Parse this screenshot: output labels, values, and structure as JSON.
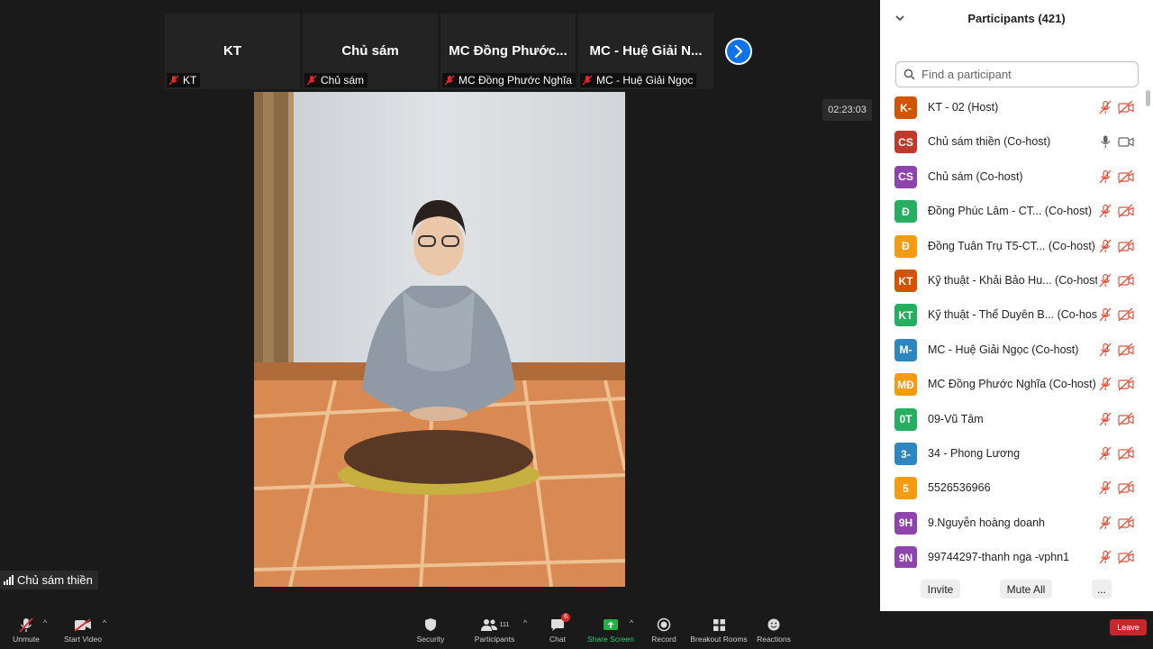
{
  "thumbnails": [
    {
      "name": "KT",
      "label": "KT"
    },
    {
      "name": "Chủ sám",
      "label": "Chủ sám"
    },
    {
      "name": "MC  Đồng  Phước...",
      "label": "MC Đồng Phước Nghĩa"
    },
    {
      "name": "MC  -  Huệ Giải N...",
      "label": "MC - Huệ Giải Ngọc"
    }
  ],
  "timer": "02:23:03",
  "active_speaker": "Chủ sám thiền",
  "toolbar": {
    "unmute": "Unmute",
    "start_video": "Start Video",
    "security": "Security",
    "participants": "Participants",
    "participants_count": "111",
    "chat": "Chat",
    "chat_badge": "6",
    "share_screen": "Share Screen",
    "record": "Record",
    "breakout_rooms": "Breakout Rooms",
    "reactions": "Reactions",
    "leave": "Leave"
  },
  "panel": {
    "title": "Participants (421)",
    "search_placeholder": "Find a participant",
    "participants": [
      {
        "initials": "K-",
        "name": "KT - 02 (Host)",
        "color": "#d35400",
        "audio": "muted",
        "video": "off"
      },
      {
        "initials": "CS",
        "name": "Chủ sám thiền (Co-host)",
        "color": "#c0392b",
        "audio": "on",
        "video": "on"
      },
      {
        "initials": "CS",
        "name": "Chủ sám (Co-host)",
        "color": "#8e44ad",
        "audio": "muted",
        "video": "off"
      },
      {
        "initials": "Đ",
        "name": "Đồng Phúc Lâm -  CT...  (Co-host)",
        "color": "#27ae60",
        "audio": "muted",
        "video": "off"
      },
      {
        "initials": "Đ",
        "name": "Đồng Tuân Trụ T5-CT...  (Co-host)",
        "color": "#f39c12",
        "audio": "muted",
        "video": "off"
      },
      {
        "initials": "KT",
        "name": "Kỹ thuật - Khải Bảo Hu...  (Co-host)",
        "color": "#d35400",
        "audio": "muted",
        "video": "off"
      },
      {
        "initials": "KT",
        "name": "Kỹ thuật - Thể Duyên B...  (Co-host)",
        "color": "#27ae60",
        "audio": "muted",
        "video": "off"
      },
      {
        "initials": "M-",
        "name": "MC - Huệ Giải Ngọc (Co-host)",
        "color": "#2e86c1",
        "audio": "muted",
        "video": "off"
      },
      {
        "initials": "MĐ",
        "name": "MC Đồng Phước Nghĩa (Co-host)",
        "color": "#f39c12",
        "audio": "muted",
        "video": "off"
      },
      {
        "initials": "0T",
        "name": "09-Vũ Tâm",
        "color": "#27ae60",
        "audio": "muted",
        "video": "off"
      },
      {
        "initials": "3-",
        "name": "34 - Phong Lương",
        "color": "#2e86c1",
        "audio": "muted",
        "video": "off"
      },
      {
        "initials": "5",
        "name": "5526536966",
        "color": "#f39c12",
        "audio": "muted",
        "video": "off"
      },
      {
        "initials": "9H",
        "name": "9.Nguyễn hoàng doanh",
        "color": "#8e44ad",
        "audio": "muted",
        "video": "off"
      },
      {
        "initials": "9N",
        "name": "99744297-thanh nga -vphn1",
        "color": "#8e44ad",
        "audio": "muted",
        "video": "off"
      }
    ],
    "footer": {
      "invite": "Invite",
      "mute_all": "Mute All",
      "more": "..."
    }
  },
  "colors": {
    "accent": "#0e72ed",
    "muted_red": "#e02828",
    "share_green": "#1fb341",
    "leave_red": "#c8262a"
  }
}
